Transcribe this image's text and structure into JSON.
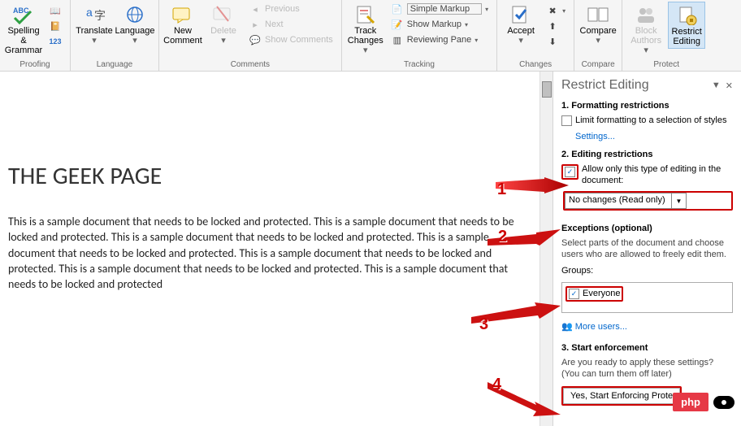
{
  "ribbon": {
    "proofing": {
      "spelling": "Spelling &\nGrammar",
      "label": "Proofing"
    },
    "language": {
      "translate": "Translate",
      "language": "Language",
      "label": "Language"
    },
    "comments": {
      "new": "New\nComment",
      "delete": "Delete",
      "previous": "Previous",
      "next": "Next",
      "show": "Show Comments",
      "label": "Comments"
    },
    "tracking": {
      "track": "Track\nChanges",
      "simple": "Simple Markup",
      "showmk": "Show Markup",
      "reviewpane": "Reviewing Pane",
      "label": "Tracking"
    },
    "changes": {
      "accept": "Accept",
      "label": "Changes"
    },
    "compare": {
      "compare": "Compare",
      "label": "Compare"
    },
    "protect": {
      "block": "Block\nAuthors",
      "restrict": "Restrict\nEditing",
      "label": "Protect"
    }
  },
  "doc": {
    "title": "THE GEEK PAGE",
    "body": "This is a sample document that needs to be locked and protected. This is a sample document that needs to be locked and protected. This is a sample document that needs to be locked and protected. This is a sample document that needs to be locked and protected. This is a sample document that needs to be locked and protected. This is a sample document that needs to be locked and protected. This is a sample document that needs to be locked and protected"
  },
  "pane": {
    "title": "Restrict Editing",
    "sec1": "1. Formatting restrictions",
    "limit": "Limit formatting to a selection of styles",
    "settings": "Settings...",
    "sec2": "2. Editing restrictions",
    "allow": "Allow only this type of editing in the document:",
    "combo": "No changes (Read only)",
    "exceptions": "Exceptions (optional)",
    "exhelp": "Select parts of the document and choose users who are allowed to freely edit them.",
    "groups": "Groups:",
    "everyone": "Everyone",
    "more": "More users...",
    "sec3": "3. Start enforcement",
    "ready": "Are you ready to apply these settings? (You can turn them off later)",
    "enforce": "Yes, Start Enforcing Prote"
  },
  "nums": {
    "n1": "1",
    "n2": "2",
    "n3": "3",
    "n4": "4"
  },
  "badge": "php"
}
